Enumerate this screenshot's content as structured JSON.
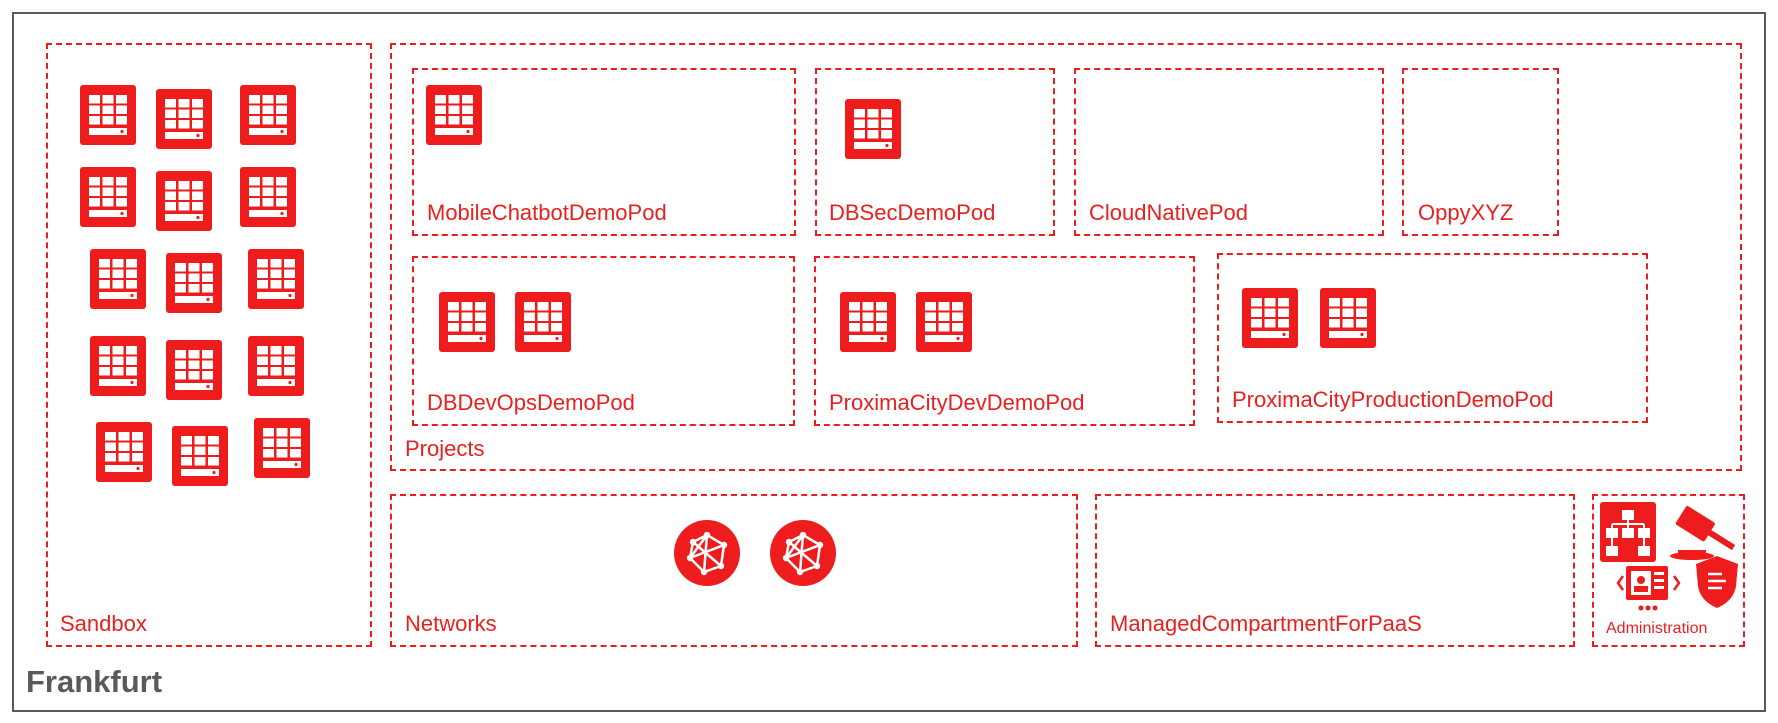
{
  "region": {
    "title": "Frankfurt"
  },
  "compartments": {
    "sandbox": "Sandbox",
    "projects": "Projects",
    "networks": "Networks",
    "managed": "ManagedCompartmentForPaaS",
    "administration": "Administration"
  },
  "pods": {
    "mobile_chatbot": "MobileChatbotDemoPod",
    "dbsec": "DBSecDemoPod",
    "cloud_native": "CloudNativePod",
    "oppy": "OppyXYZ",
    "dbdevops": "DBDevOpsDemoPod",
    "proxima_dev": "ProximaCityDevDemoPod",
    "proxima_prod": "ProximaCityProductionDemoPod"
  },
  "icons": {
    "compute": "compute-instance-icon",
    "network": "virtual-cloud-network-icon",
    "admin": [
      "compartment-hierarchy-icon",
      "governance-gavel-icon",
      "identity-console-icon",
      "security-shield-icon"
    ]
  },
  "colors": {
    "accent": "#ee1c1c",
    "region_border": "#5a5a5a",
    "region_title": "#5a5a5a"
  }
}
